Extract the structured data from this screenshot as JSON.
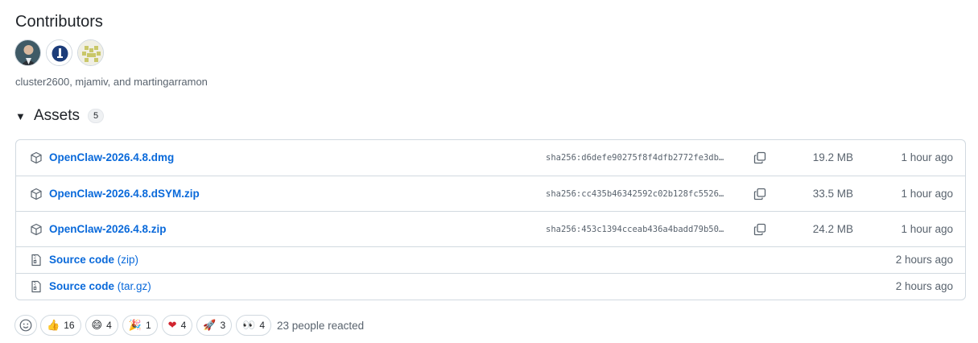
{
  "contributors": {
    "title": "Contributors",
    "names": "cluster2600, mjamiv, and martingarramon",
    "avatars": [
      "cluster2600",
      "mjamiv",
      "martingarramon"
    ]
  },
  "assets": {
    "title": "Assets",
    "count": "5",
    "rows": [
      {
        "name": "OpenClaw-2026.4.8.dmg",
        "sha": "sha256:d6defe90275f8f4dfb2772fe3db…",
        "size": "19.2 MB",
        "time": "1 hour ago",
        "icon": "package-icon"
      },
      {
        "name": "OpenClaw-2026.4.8.dSYM.zip",
        "sha": "sha256:cc435b46342592c02b128fc5526…",
        "size": "33.5 MB",
        "time": "1 hour ago",
        "icon": "package-icon"
      },
      {
        "name": "OpenClaw-2026.4.8.zip",
        "sha": "sha256:453c1394cceab436a4badd79b50…",
        "size": "24.2 MB",
        "time": "1 hour ago",
        "icon": "package-icon"
      },
      {
        "name": "Source code",
        "ext": "(zip)",
        "time": "2 hours ago",
        "icon": "file-zip-icon"
      },
      {
        "name": "Source code",
        "ext": "(tar.gz)",
        "time": "2 hours ago",
        "icon": "file-zip-icon"
      }
    ]
  },
  "reactions": {
    "items": [
      {
        "emoji": "👍",
        "count": "16"
      },
      {
        "emoji": "😄",
        "count": "4"
      },
      {
        "emoji": "🎉",
        "count": "1"
      },
      {
        "emoji": "❤",
        "count": "4"
      },
      {
        "emoji": "🚀",
        "count": "3"
      },
      {
        "emoji": "👀",
        "count": "4"
      }
    ],
    "summary": "23 people reacted"
  },
  "colors": {
    "link": "#0969da",
    "muted": "#59636e",
    "border": "#d1d9e0"
  }
}
